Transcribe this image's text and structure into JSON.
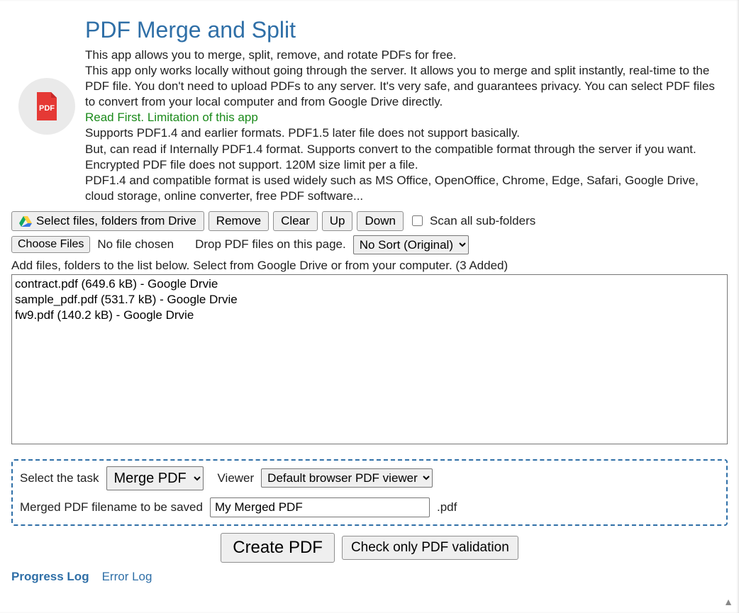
{
  "header": {
    "title": "PDF Merge and Split",
    "desc_line1": "This app allows you to merge, split, remove, and rotate PDFs for free.",
    "desc_line2": "This app only works locally without going through the server. It allows you to merge and split instantly, real-time to the PDF file. You don't need to upload PDFs to any server. It's very safe, and guarantees privacy. You can select PDF files to convert from your local computer and from Google Drive directly.",
    "limitation_title": "Read First. Limitation of this app",
    "limitation_body": "Supports PDF1.4 and earlier formats. PDF1.5 later file does not support basically.\nBut, can read if Internally PDF1.4 format. Supports convert to the compatible format through the server if you want. Encrypted PDF file does not support. 120M size limit per a file.\nPDF1.4 and compatible format is used widely such as MS Office, OpenOffice, Chrome, Edge, Safari, Google Drive, cloud storage, online converter, free PDF software..."
  },
  "toolbar": {
    "drive_button": "Select files, folders from Drive",
    "remove": "Remove",
    "clear": "Clear",
    "up": "Up",
    "down": "Down",
    "scan_label": "Scan all sub-folders"
  },
  "row2": {
    "choose_files": "Choose Files",
    "no_file_chosen": "No file chosen",
    "drop_label": "Drop PDF files on this page.",
    "sort_options": [
      "No Sort (Original)"
    ],
    "sort_selected": "No Sort (Original)"
  },
  "instructions": "Add files, folders to the list below. Select from Google Drive or from your computer. (3 Added)",
  "files": [
    "contract.pdf (649.6 kB) - Google Drvie",
    "sample_pdf.pdf (531.7 kB) - Google Drvie",
    "fw9.pdf (140.2 kB) - Google Drvie"
  ],
  "task": {
    "select_label": "Select the task",
    "task_options": [
      "Merge PDF"
    ],
    "task_selected": "Merge PDF",
    "viewer_label": "Viewer",
    "viewer_options": [
      "Default browser PDF viewer"
    ],
    "viewer_selected": "Default browser PDF viewer",
    "filename_label": "Merged PDF filename to be saved",
    "filename_value": "My Merged PDF",
    "filename_suffix": ".pdf"
  },
  "actions": {
    "create": "Create PDF",
    "validate": "Check only PDF validation"
  },
  "log_links": {
    "progress": "Progress Log",
    "error": "Error Log"
  }
}
